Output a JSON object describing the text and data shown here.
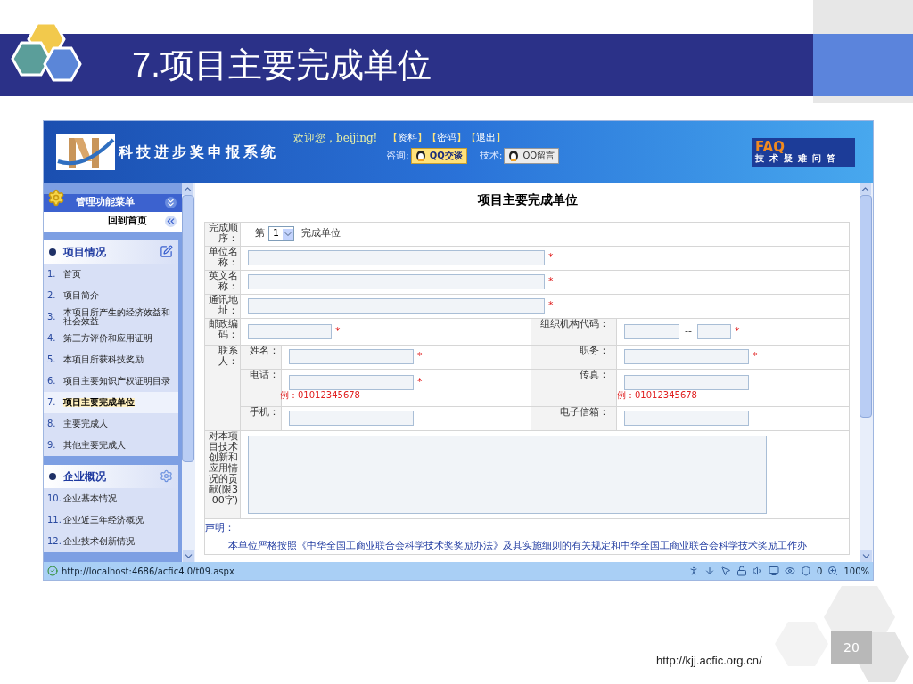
{
  "slide": {
    "title": "7.项目主要完成单位",
    "url": "http://kjj.acfic.org.cn/",
    "page_number": "20"
  },
  "header": {
    "system_name": "科技进步奖申报系统",
    "welcome": "欢迎您，beijing!",
    "links": [
      {
        "open": "【",
        "label": "资料",
        "close": "】"
      },
      {
        "open": "【",
        "label": "密码",
        "close": "】"
      },
      {
        "open": "【",
        "label": "退出",
        "close": "】"
      }
    ],
    "consult_label": "咨询:",
    "qq_chat": "QQ交谈",
    "tech_label": "技术:",
    "qq_message": "QQ留言",
    "faq_title": "FAQ",
    "faq_subtitle": "技术疑难问答"
  },
  "sidebar": {
    "menu_title": "管理功能菜单",
    "home": "回到首页",
    "sections": [
      {
        "title": "项目情况",
        "items": [
          {
            "number": "1.",
            "label": "首页",
            "selected": false
          },
          {
            "number": "2.",
            "label": "项目简介",
            "selected": false
          },
          {
            "number": "3.",
            "label": "本项目所产生的经济效益和社会效益",
            "selected": false
          },
          {
            "number": "4.",
            "label": "第三方评价和应用证明",
            "selected": false
          },
          {
            "number": "5.",
            "label": "本项目所获科技奖励",
            "selected": false
          },
          {
            "number": "6.",
            "label": "项目主要知识产权证明目录",
            "selected": false
          },
          {
            "number": "7.",
            "label": "项目主要完成单位",
            "selected": true
          },
          {
            "number": "8.",
            "label": "主要完成人",
            "selected": false
          },
          {
            "number": "9.",
            "label": "其他主要完成人",
            "selected": false
          }
        ]
      },
      {
        "title": "企业概况",
        "items": [
          {
            "number": "10.",
            "label": "企业基本情况",
            "selected": false
          },
          {
            "number": "11.",
            "label": "企业近三年经济概况",
            "selected": false
          },
          {
            "number": "12.",
            "label": "企业技术创新情况",
            "selected": false
          }
        ]
      }
    ]
  },
  "form": {
    "title": "项目主要完成单位",
    "order": {
      "label": "完成顺序：",
      "prefix": "第",
      "value": "1",
      "suffix": "完成单位"
    },
    "rows": [
      {
        "label": "单位名称：",
        "mark": "*"
      },
      {
        "label": "英文名称：",
        "mark": "*"
      },
      {
        "label": "通讯地址：",
        "mark": "*"
      }
    ],
    "postal": {
      "label": "邮政编码：",
      "mark": "*"
    },
    "org_code": {
      "label": "组织机构代码：",
      "separator": "--",
      "mark": "*"
    },
    "contact": {
      "label": "联系人：",
      "rows": [
        [
          {
            "label": "姓名：",
            "mark": "*"
          },
          {
            "label": "职务：",
            "mark": "*"
          }
        ],
        [
          {
            "label": "电话：",
            "mark": "*",
            "example": "例：01012345678"
          },
          {
            "label": "传真：",
            "example": "例：01012345678"
          }
        ],
        [
          {
            "label": "手机："
          },
          {
            "label": "电子信箱："
          }
        ]
      ]
    },
    "contribution": {
      "label": "对本项目技术创新和应用情况的贡献(限300字)"
    },
    "statement": {
      "label": "声明：",
      "text": "本单位严格按照《中华全国工商业联合会科学技术奖奖励办法》及其实施细则的有关规定和中华全国工商业联合会科学技术奖励工作办"
    }
  },
  "status_bar": {
    "url": "http://localhost:4686/acfic4.0/t09.aspx",
    "count": "0",
    "zoom": "100%"
  }
}
